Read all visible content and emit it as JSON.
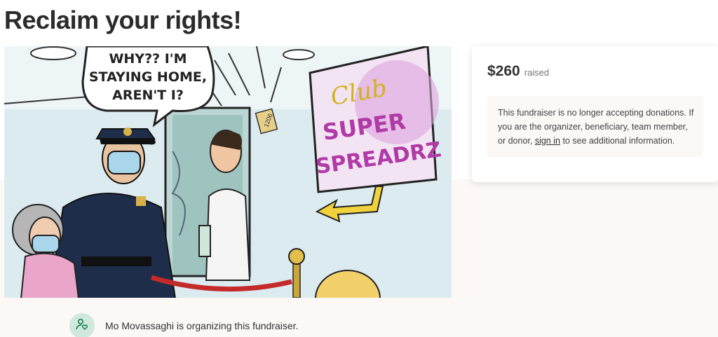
{
  "page": {
    "title": "Reclaim your rights!"
  },
  "hero_image": {
    "speech_bubble": [
      "WHY?? I'M",
      "STAYING HOME,",
      "AREN'T I?"
    ],
    "sign": {
      "line1": "Club",
      "line2": "SUPER",
      "line3": "SPREADRZ"
    },
    "door_number": "1206"
  },
  "donation": {
    "amount": "$260",
    "raised_label": "raised",
    "notice_before_link": "This fundraiser is no longer accepting donations. If you are the organizer, beneficiary, team member, or donor, ",
    "notice_link": "sign in",
    "notice_after_link": " to see additional information."
  },
  "organizer": {
    "text": "Mo Movassaghi is organizing this fundraiser.",
    "icon": "person-heart-icon"
  },
  "colors": {
    "background_warm": "#fbf8f6",
    "avatar_bg": "#cfe9dc",
    "accent_green": "#1a7f4b"
  }
}
